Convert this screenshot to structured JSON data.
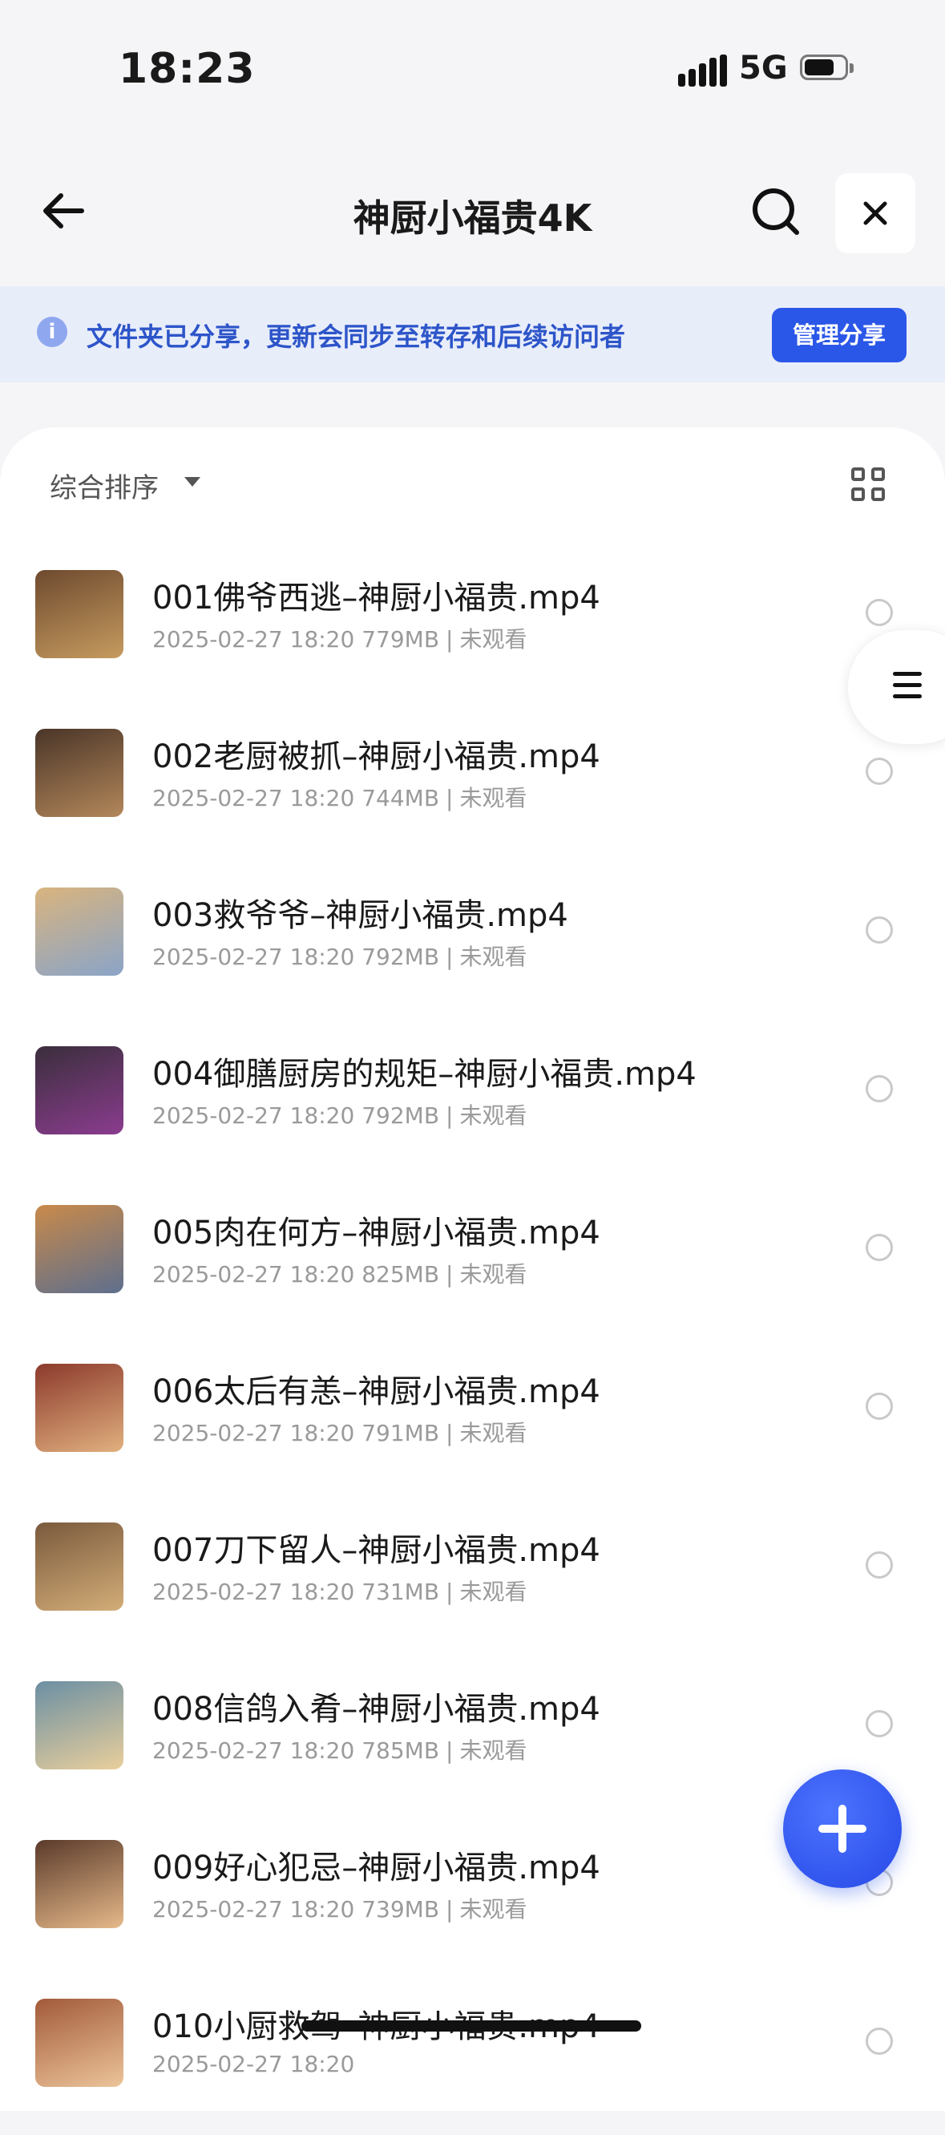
{
  "status_bar": {
    "time": "18:23",
    "network": "5G"
  },
  "nav": {
    "title": "神厨小福贵4K"
  },
  "share_banner": {
    "text": "文件夹已分享，更新会同步至转存和后续访问者",
    "button": "管理分享",
    "info_glyph": "i"
  },
  "toolbar": {
    "sort_label": "综合排序"
  },
  "files": [
    {
      "name": "001佛爷西逃–神厨小福贵.mp4",
      "date": "2025-02-27 18:20",
      "size": "779MB",
      "status": "未观看",
      "thumb_colors": [
        "#6e4a2f",
        "#c69b5f"
      ]
    },
    {
      "name": "002老厨被抓–神厨小福贵.mp4",
      "date": "2025-02-27 18:20",
      "size": "744MB",
      "status": "未观看",
      "thumb_colors": [
        "#4a3528",
        "#b3875a"
      ]
    },
    {
      "name": "003救爷爷–神厨小福贵.mp4",
      "date": "2025-02-27 18:20",
      "size": "792MB",
      "status": "未观看",
      "thumb_colors": [
        "#d9b47e",
        "#8aa4c8"
      ]
    },
    {
      "name": "004御膳厨房的规矩–神厨小福贵.mp4",
      "date": "2025-02-27 18:20",
      "size": "792MB",
      "status": "未观看",
      "thumb_colors": [
        "#3a2e3c",
        "#8b3c8f"
      ]
    },
    {
      "name": "005肉在何方–神厨小福贵.mp4",
      "date": "2025-02-27 18:20",
      "size": "825MB",
      "status": "未观看",
      "thumb_colors": [
        "#c98a4a",
        "#5e6f8e"
      ]
    },
    {
      "name": "006太后有恙–神厨小福贵.mp4",
      "date": "2025-02-27 18:20",
      "size": "791MB",
      "status": "未观看",
      "thumb_colors": [
        "#8c3a2c",
        "#e1b07f"
      ]
    },
    {
      "name": "007刀下留人–神厨小福贵.mp4",
      "date": "2025-02-27 18:20",
      "size": "731MB",
      "status": "未观看",
      "thumb_colors": [
        "#7a5a3d",
        "#d3ad78"
      ]
    },
    {
      "name": "008信鸽入肴–神厨小福贵.mp4",
      "date": "2025-02-27 18:20",
      "size": "785MB",
      "status": "未观看",
      "thumb_colors": [
        "#6b8fa3",
        "#e9cf9c"
      ]
    },
    {
      "name": "009好心犯忌–神厨小福贵.mp4",
      "date": "2025-02-27 18:20",
      "size": "739MB",
      "status": "未观看",
      "thumb_colors": [
        "#5a3a2a",
        "#e6b98a"
      ]
    },
    {
      "name": "010小厨救驾–神厨小福贵.mp4",
      "date": "2025-02-27 18:20",
      "size": "",
      "status": "",
      "thumb_colors": [
        "#a25a3a",
        "#ecc49a"
      ]
    }
  ],
  "colors": {
    "accent": "#2b57e8",
    "banner_bg": "#e8edfa",
    "banner_text": "#2d55c9",
    "page_bg": "#f5f5f7"
  }
}
